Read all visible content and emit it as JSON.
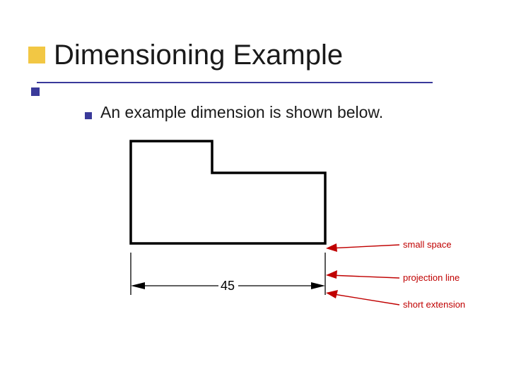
{
  "slide": {
    "title": "Dimensioning Example",
    "bullet": "An example dimension is shown below."
  },
  "diagram": {
    "dimension_value": "45",
    "labels": {
      "small_space": "small space",
      "projection_line": "projection line",
      "short_extension": "short extension"
    }
  },
  "colors": {
    "accent_blue": "#3a3a9a",
    "accent_yellow": "#f2c744",
    "callout_red": "#c00000"
  }
}
